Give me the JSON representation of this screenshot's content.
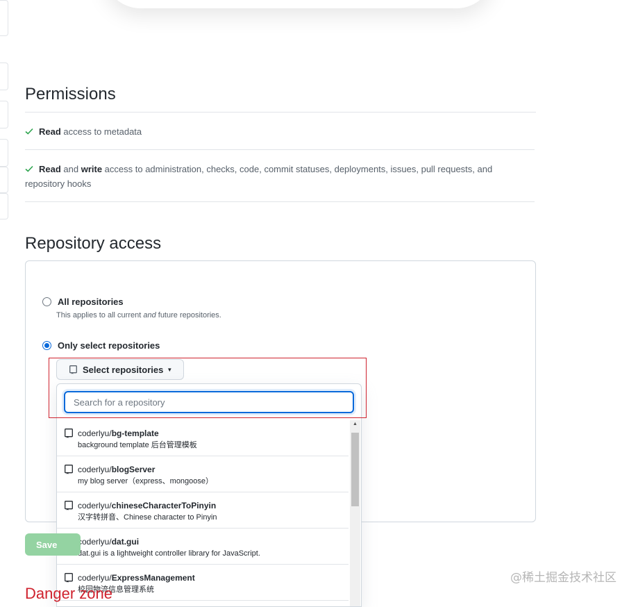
{
  "permissions": {
    "title": "Permissions",
    "rows": [
      {
        "bold1": "Read",
        "text1": " access to metadata",
        "bold2": "",
        "text2": ""
      },
      {
        "bold1": "Read",
        "text1": " and ",
        "bold2": "write",
        "text2": " access to administration, checks, code, commit statuses, deployments, issues, pull requests, and repository hooks"
      }
    ]
  },
  "repository_access": {
    "title": "Repository access",
    "all": {
      "label": "All repositories",
      "note_pre": "This applies to all current ",
      "note_em": "and",
      "note_post": " future repositories."
    },
    "only": {
      "label": "Only select repositories"
    },
    "select_button": {
      "label": "Select repositories"
    },
    "search": {
      "placeholder": "Search for a repository",
      "value": ""
    },
    "repos": [
      {
        "owner": "coderlyu/",
        "name": "bg-template",
        "desc": "background template 后台管理模板",
        "icon": "repo-icon"
      },
      {
        "owner": "coderlyu/",
        "name": "blogServer",
        "desc": "my blog server（express、mongoose）",
        "icon": "repo-icon"
      },
      {
        "owner": "coderlyu/",
        "name": "chineseCharacterToPinyin",
        "desc": "汉字转拼音、Chinese character to Pinyin",
        "icon": "repo-icon"
      },
      {
        "owner": "coderlyu/",
        "name": "dat.gui",
        "desc": "dat.gui is a lightweight controller library for JavaScript.",
        "icon": "fork-icon"
      },
      {
        "owner": "coderlyu/",
        "name": "ExpressManagement",
        "desc": "校园物流信息管理系统",
        "icon": "repo-icon"
      }
    ]
  },
  "save_button": {
    "label": "Save"
  },
  "danger_zone": {
    "title": "Danger zone"
  },
  "watermark": "@稀土掘金技术社区",
  "colors": {
    "accent": "#0969da",
    "success": "#2da44e",
    "danger": "#cf222e",
    "highlight": "#cf222e"
  }
}
